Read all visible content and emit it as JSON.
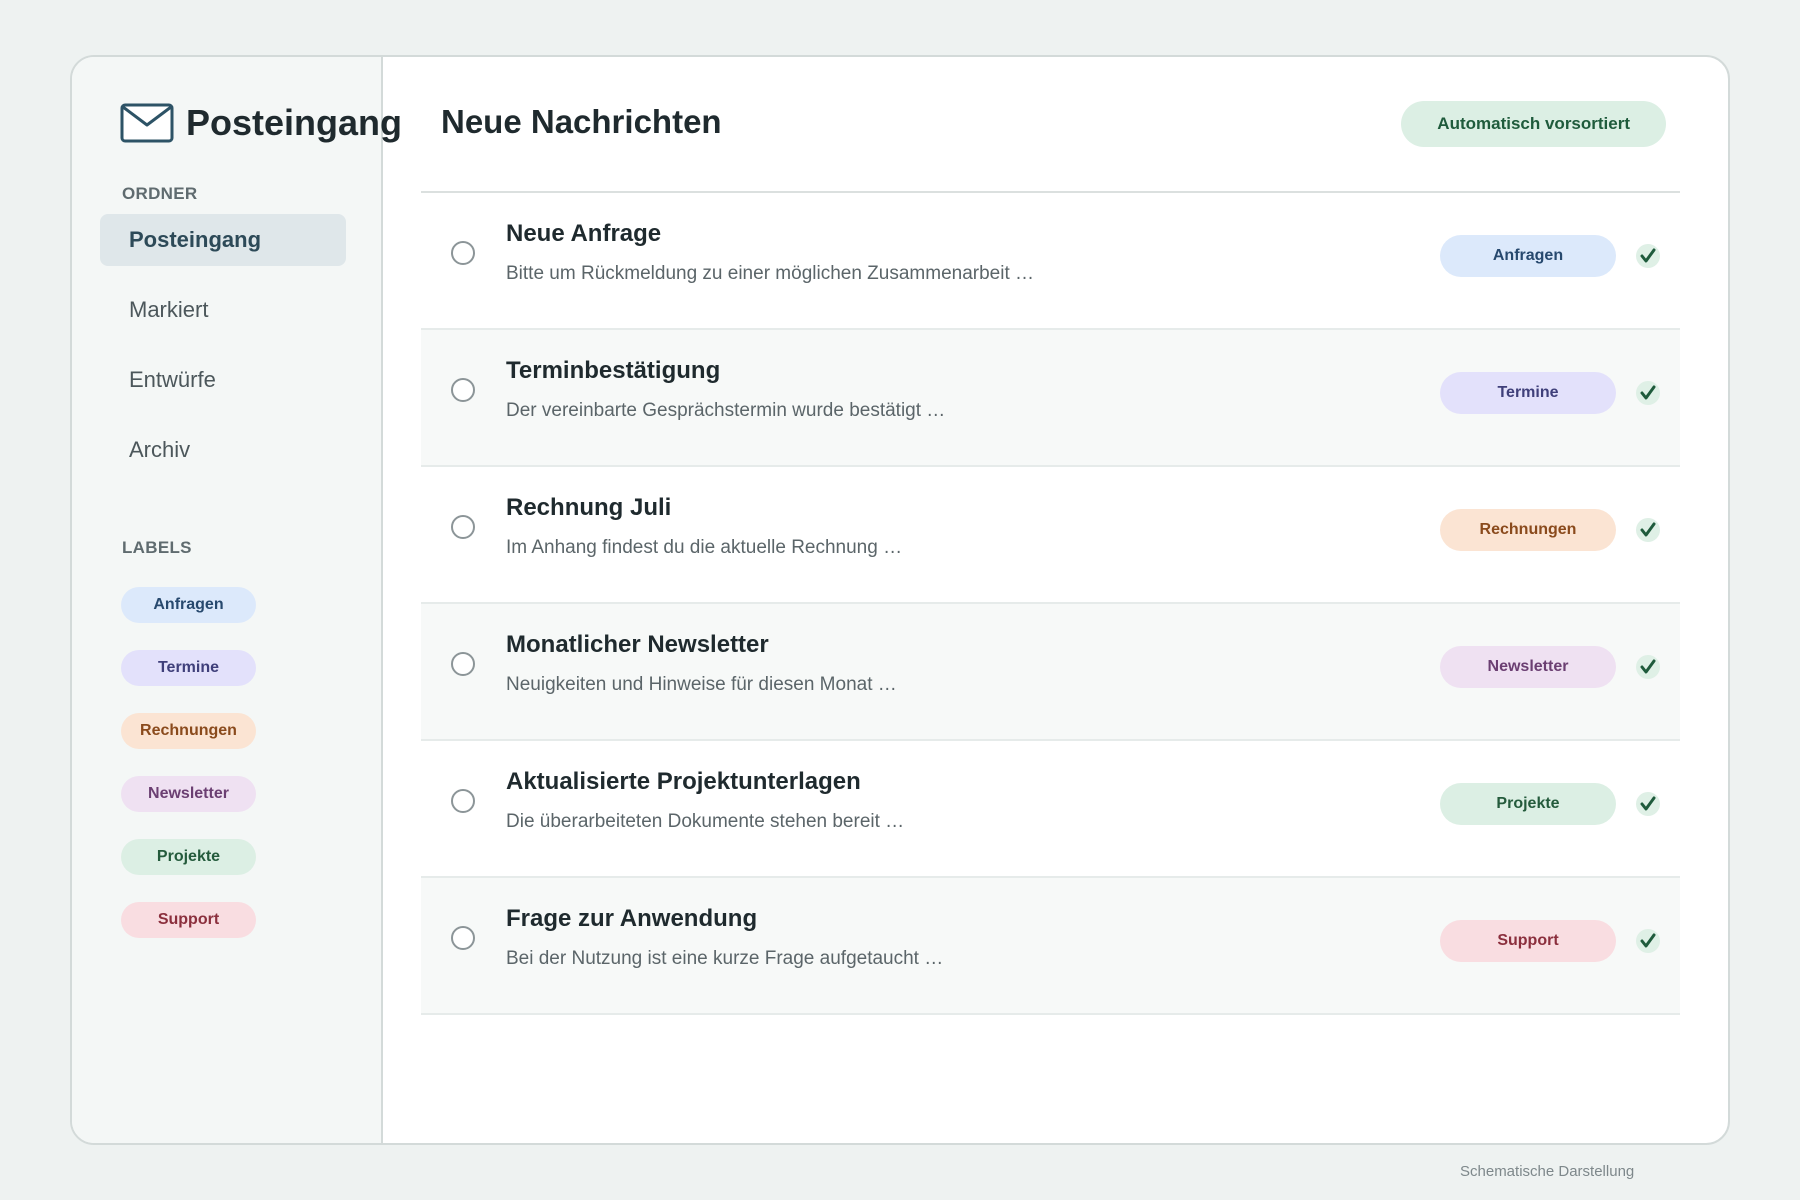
{
  "sidebar": {
    "title": "Posteingang",
    "folders_heading": "ORDNER",
    "folders": [
      {
        "label": "Posteingang",
        "active": true
      },
      {
        "label": "Markiert",
        "active": false
      },
      {
        "label": "Entwürfe",
        "active": false
      },
      {
        "label": "Archiv",
        "active": false
      }
    ],
    "labels_heading": "LABELS",
    "labels": [
      {
        "label": "Anfragen",
        "bg": "#dce9fb",
        "fg": "#27496e"
      },
      {
        "label": "Termine",
        "bg": "#e3e1fb",
        "fg": "#3f3f7a"
      },
      {
        "label": "Rechnungen",
        "bg": "#fbe4d3",
        "fg": "#8a4a1c"
      },
      {
        "label": "Newsletter",
        "bg": "#efe1f2",
        "fg": "#6b3f72"
      },
      {
        "label": "Projekte",
        "bg": "#dcefe4",
        "fg": "#245b3c"
      },
      {
        "label": "Support",
        "bg": "#f9dde1",
        "fg": "#8b2f3d"
      }
    ]
  },
  "main": {
    "title": "Neue Nachrichten",
    "auto_badge": "Automatisch vorsortiert",
    "messages": [
      {
        "subject": "Neue Anfrage",
        "preview": "Bitte um Rückmeldung zu einer möglichen Zusammenarbeit …",
        "label": "Anfragen",
        "bg": "#dce9fb",
        "fg": "#27496e"
      },
      {
        "subject": "Terminbestätigung",
        "preview": "Der vereinbarte Gesprächstermin wurde bestätigt …",
        "label": "Termine",
        "bg": "#e3e1fb",
        "fg": "#3f3f7a"
      },
      {
        "subject": "Rechnung Juli",
        "preview": "Im Anhang findest du die aktuelle Rechnung …",
        "label": "Rechnungen",
        "bg": "#fbe4d3",
        "fg": "#8a4a1c"
      },
      {
        "subject": "Monatlicher Newsletter",
        "preview": "Neuigkeiten und Hinweise für diesen Monat …",
        "label": "Newsletter",
        "bg": "#efe1f2",
        "fg": "#6b3f72"
      },
      {
        "subject": "Aktualisierte Projektunterlagen",
        "preview": "Die überarbeiteten Dokumente stehen bereit …",
        "label": "Projekte",
        "bg": "#dcefe4",
        "fg": "#245b3c"
      },
      {
        "subject": "Frage zur Anwendung",
        "preview": "Bei der Nutzung ist eine kurze Frage aufgetaucht …",
        "label": "Support",
        "bg": "#f9dde1",
        "fg": "#8b2f3d"
      }
    ]
  },
  "footnote": "Schematische Darstellung",
  "icons": {
    "brand": "envelope-icon",
    "status": "check-icon",
    "select": "radio-icon"
  },
  "colors": {
    "accent": "#2d4a58",
    "check": "#1f5b3c",
    "background": "#eef2f1"
  }
}
